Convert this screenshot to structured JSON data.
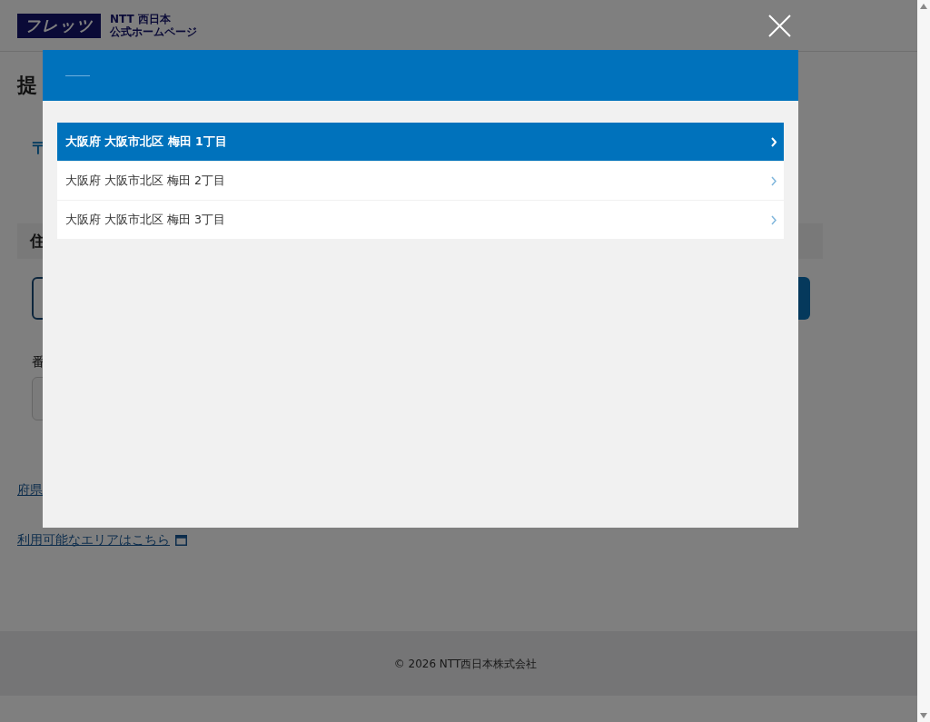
{
  "header": {
    "logo": "フレッツ",
    "site_name": [
      "NTT 西日本",
      "公式ホームページ"
    ]
  },
  "page": {
    "heading": "提",
    "postal_label": "〒",
    "section_title": "住",
    "number_label": "番",
    "prefecture_link": "府県",
    "area_link": "利用可能なエリアはこちら"
  },
  "modal": {
    "items": [
      {
        "label": "大阪府 大阪市北区 梅田 1丁目",
        "selected": true
      },
      {
        "label": "大阪府 大阪市北区 梅田 2丁目",
        "selected": false
      },
      {
        "label": "大阪府 大阪市北区 梅田 3丁目",
        "selected": false
      }
    ]
  },
  "footer": {
    "copyright": "© 2026 NTT西日本株式会社"
  }
}
